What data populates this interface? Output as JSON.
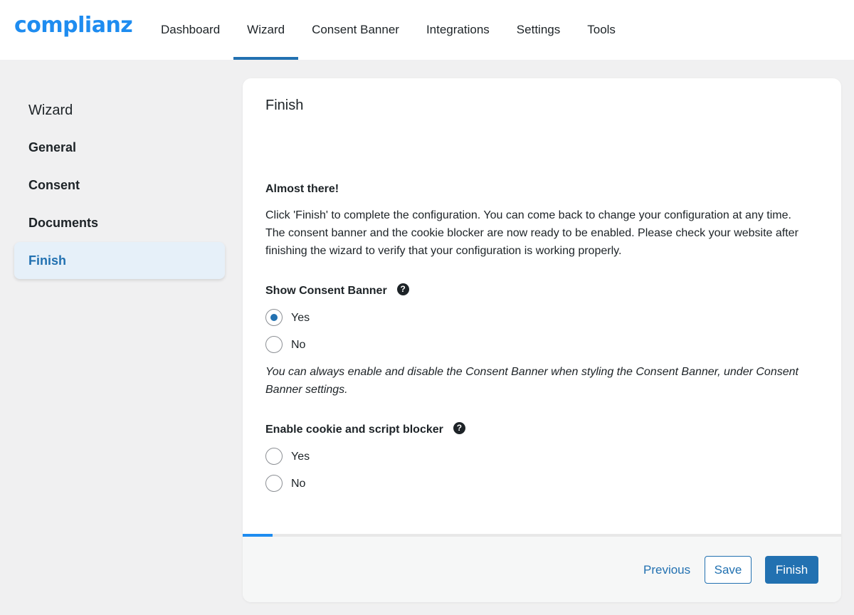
{
  "app": {
    "logo_text": "complianz",
    "accent_color": "#2271b1",
    "brand_color": "#1e8cf0"
  },
  "nav": {
    "items": [
      {
        "label": "Dashboard"
      },
      {
        "label": "Wizard",
        "active": true
      },
      {
        "label": "Consent Banner"
      },
      {
        "label": "Integrations"
      },
      {
        "label": "Settings"
      },
      {
        "label": "Tools"
      }
    ]
  },
  "sidebar": {
    "title": "Wizard",
    "items": [
      {
        "label": "General"
      },
      {
        "label": "Consent"
      },
      {
        "label": "Documents"
      },
      {
        "label": "Finish",
        "active": true
      }
    ]
  },
  "main": {
    "title": "Finish",
    "intro_title": "Almost there!",
    "intro_line1": "Click 'Finish' to complete the configuration. You can come back to change your configuration at any time.",
    "intro_line2": "The consent banner and the cookie blocker are now ready to be enabled. Please check your website after finishing the wizard to verify that your configuration is working properly.",
    "fields": [
      {
        "label": "Show Consent Banner",
        "options": [
          {
            "label": "Yes",
            "checked": true
          },
          {
            "label": "No",
            "checked": false
          }
        ],
        "note": "You can always enable and disable the Consent Banner when styling the Consent Banner, under Consent Banner settings."
      },
      {
        "label": "Enable cookie and script blocker",
        "options": [
          {
            "label": "Yes",
            "checked": false
          },
          {
            "label": "No",
            "checked": false
          }
        ]
      }
    ],
    "progress_percent": 5,
    "help_icon_glyph": "?"
  },
  "footer": {
    "previous_label": "Previous",
    "save_label": "Save",
    "finish_label": "Finish"
  }
}
